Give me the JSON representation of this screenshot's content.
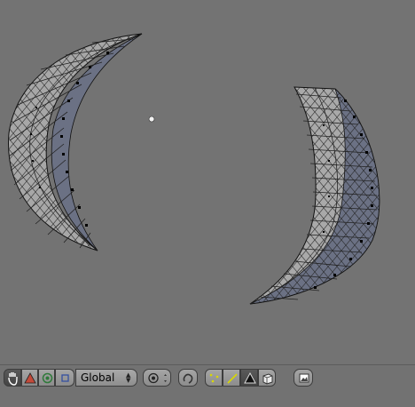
{
  "viewport": {
    "background": "#737373",
    "objects": [
      "crescent-mesh-left",
      "crescent-mesh-right"
    ],
    "center_point": "origin-dot"
  },
  "header": {
    "mode_icons": [
      "hand-icon",
      "vertex-paint-icon",
      "solid-icon",
      "object-icon"
    ],
    "transform_orientation": "Global",
    "pivot_icon": "pivot-icon",
    "snap_icon": "magnet-icon",
    "select_modes": [
      "vertex-select-icon",
      "edge-select-icon",
      "face-select-icon"
    ],
    "occlude_icon": "cube-icon",
    "render_icon": "render-icon",
    "colors": {
      "button": "#9a9a9a",
      "active": "#4a4a4a",
      "header": "#727272"
    }
  }
}
